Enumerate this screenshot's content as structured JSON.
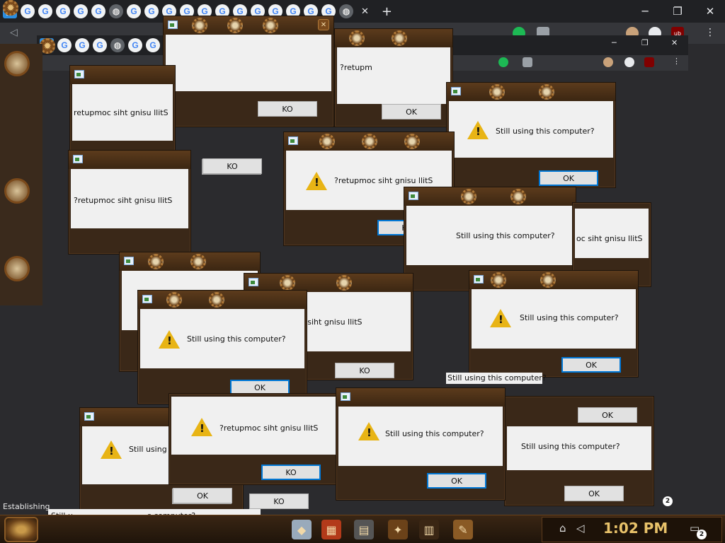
{
  "browser": {
    "new_tab_symbol": "+",
    "minimize_symbol": "─",
    "maximize_symbol": "❐",
    "close_symbol": "✕",
    "tab_close_symbol": "✕",
    "menu_symbol": "⋮",
    "back_symbol": "◁",
    "google_letter": "G",
    "extension_badge": "ub"
  },
  "dialog": {
    "message": "Still using this computer?",
    "message_reversed": "?retupmoc siht gnisu llitS",
    "ok_label": "OK",
    "ok_reversed_label": "KO",
    "close_symbol": "✕",
    "fragments": {
      "partial_1": "Still using this computer?",
      "partial_2": "Still u",
      "partial_3": "s computer?",
      "partial_4": "?retupm",
      "partial_5": "oc siht gnisu llitS",
      "partial_6": "?retupmoc siht gnisu llitS",
      "partial_7": "retupmoc siht gnisu llitS"
    }
  },
  "status_bar": {
    "text": "Establishing"
  },
  "taskbar": {
    "clock": "1:02 PM",
    "notification_count": "2",
    "tray_badge": "2"
  },
  "colors": {
    "desktop": "#2b2b2e",
    "dialog_frame": "#3a2818",
    "dialog_body": "#f0f0f0",
    "warning_yellow": "#e8b415",
    "clock_gold": "#e8c26a"
  },
  "icons": {
    "warning": "warning-triangle-icon",
    "app": "dialog-app-icon",
    "start": "steampunk-start-icon"
  }
}
